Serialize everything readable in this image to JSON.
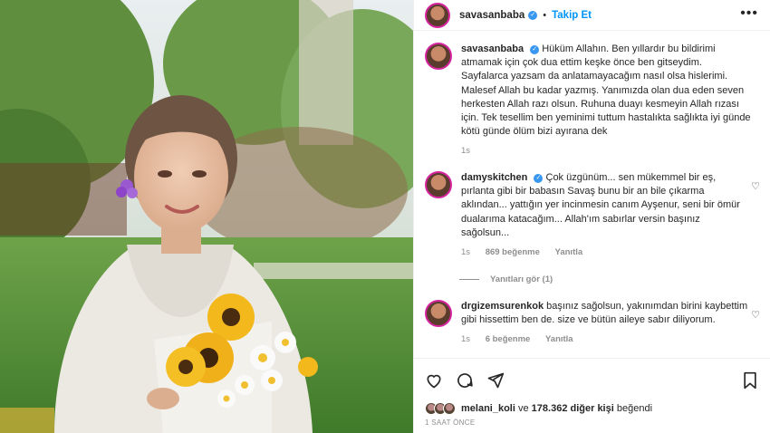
{
  "post": {
    "username": "savasanbaba",
    "follow_label": "Takip Et",
    "more_label": "•••",
    "verified_glyph": "✓",
    "separator": "•"
  },
  "caption": {
    "username": "savasanbaba",
    "text": "Hüküm Allahın. Ben yıllardır bu bildirimi atmamak için çok dua ettim keşke önce ben gitseydim. Sayfalarca yazsam da anlatamayacağım nasıl olsa hislerimi. Malesef Allah bu kadar yazmış. Yanımızda olan dua eden seven herkesten Allah razı olsun. Ruhuna duayı kesmeyin Allah rızası için. Tek tesellim ben yeminimi tuttum hastalıkta sağlıkta iyi günde kötü günde ölüm bizi ayırana dek",
    "time": "1s"
  },
  "comments": [
    {
      "username": "damyskitchen",
      "text": "Çok üzgünüm... sen mükemmel bir eş, pırlanta gibi bir babasın Savaş bunu bir an bile çıkarma aklından... yattığın yer incinmesin canım Ayşenur, seni bir ömür dualarıma katacağım... Allah'ım sabırlar versin başınız sağolsun...",
      "time": "1s",
      "likes": "869 beğenme",
      "reply_label": "Yanıtla",
      "view_replies": "Yanıtları gör (1)"
    },
    {
      "username": "drgizemsurenkok",
      "text": "başınız sağolsun, yakınımdan birini kaybettim gibi hissettim ben de. size ve bütün aileye sabır diliyorum.",
      "time": "1s",
      "likes": "6 beğenme",
      "reply_label": "Yanıtla"
    }
  ],
  "actions": {
    "liked_by_user": "melani_koli",
    "liked_by_connector": "ve",
    "likes_count": "178.362 diğer kişi",
    "likes_suffix": "beğendi",
    "time_ago": "1 SAAT ÖNCE"
  },
  "icons": {
    "heart": "heart-icon",
    "comment": "comment-icon",
    "share": "share-icon",
    "save": "bookmark-icon",
    "more": "more-icon"
  },
  "colors": {
    "accent": "#0095f6",
    "verified": "#3897f0",
    "muted": "#8e8e8e",
    "text": "#262626"
  }
}
